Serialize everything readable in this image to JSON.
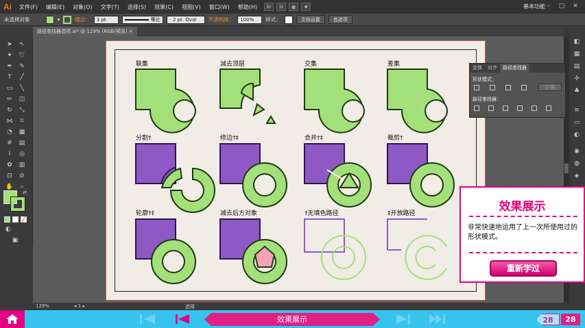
{
  "app": {
    "logo": "Ai"
  },
  "menu": [
    "文件(F)",
    "编辑(E)",
    "对象(O)",
    "文字(T)",
    "选择(S)",
    "效果(C)",
    "视图(V)",
    "窗口(W)",
    "帮助(H)"
  ],
  "menu_buttons": [
    "Br",
    "St"
  ],
  "workspace": "基本功能",
  "control_bar": {
    "selection": "未选择对象",
    "stroke_label": "描边：",
    "stroke_weight": "3 pt",
    "stroke_profile": "等比",
    "brush": "2 pt. Oval",
    "opacity_label": "不透明度：",
    "opacity": "100%",
    "style_label": "样式：",
    "doc_settings": "文档设置",
    "preferences": "首选项",
    "fill_color": "#a4e07a"
  },
  "document_tab": "路径查找器选项.ai* @ 129% (RGB/预览)",
  "artboard": {
    "labels": {
      "unite": "联集",
      "minus_front": "减去顶层",
      "intersect": "交集",
      "exclude": "差集",
      "divide": "分割†",
      "trim": "修边†‡",
      "merge": "合并†‡",
      "crop": "裁剪†",
      "outline": "轮廓†‡",
      "minus_back": "减去后方对象",
      "no_fill_path": "†无填色路径",
      "open_path": "‡开放路径"
    },
    "colors": {
      "green": "#a4e07a",
      "purple": "#8e59c4",
      "pink": "#f4a2b8",
      "outline": "#1d3a12"
    }
  },
  "pathfinder_panel": {
    "tabs": [
      "变换",
      "对齐",
      "路径查找器"
    ],
    "shape_modes": "形状模式：",
    "expand": "扩展",
    "pathfinders": "路径查找器："
  },
  "status": {
    "zoom": "129%",
    "tool": "选择",
    "page": "1"
  },
  "card": {
    "title": "效果展示",
    "text": "非常快速地运用了上一次所使用过的形状模式。",
    "button": "重新学过"
  },
  "bottom_nav": {
    "title": "效果展示",
    "prev_page": "28",
    "current_page": "28"
  }
}
